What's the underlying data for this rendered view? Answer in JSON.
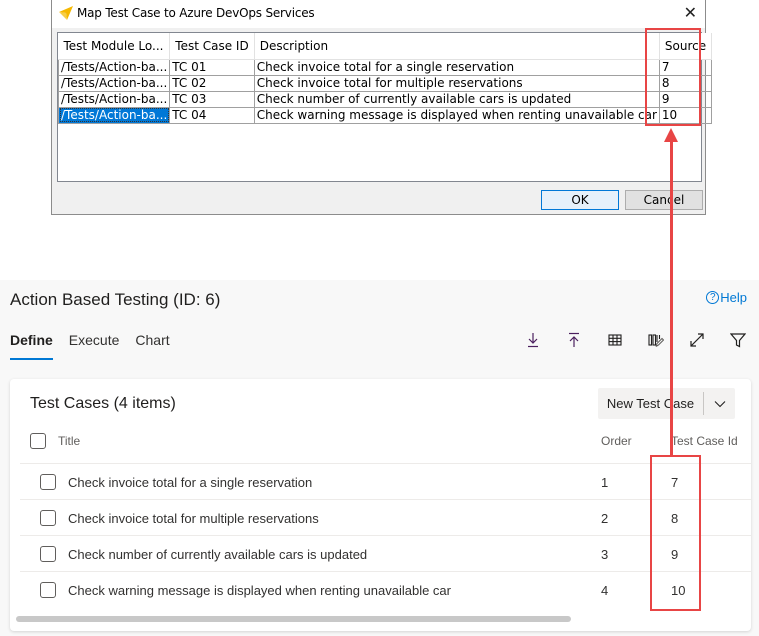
{
  "dialog": {
    "title": "Map Test Case to Azure DevOps Services",
    "close_glyph": "✕",
    "columns": [
      "Test Module Lo...",
      "Test Case ID",
      "Description",
      "Source"
    ],
    "rows": [
      {
        "module": "/Tests/Action-ba...",
        "id": "TC 01",
        "description": "Check invoice total for a single reservation",
        "source": "7"
      },
      {
        "module": "/Tests/Action-ba...",
        "id": "TC 02",
        "description": "Check invoice total for multiple reservations",
        "source": "8"
      },
      {
        "module": "/Tests/Action-ba...",
        "id": "TC 03",
        "description": "Check number of currently available cars is updated",
        "source": "9"
      },
      {
        "module": "/Tests/Action-ba...",
        "id": "TC 04",
        "description": "Check warning message is displayed when renting unavailable car",
        "source": "10"
      }
    ],
    "selected_row": 3,
    "ok_label": "OK",
    "cancel_label": "Cancel"
  },
  "page": {
    "title": "Action Based Testing (ID: 6)",
    "help_label": "Help",
    "help_glyph": "?",
    "tabs": [
      {
        "label": "Define",
        "active": true
      },
      {
        "label": "Execute",
        "active": false
      },
      {
        "label": "Chart",
        "active": false
      }
    ],
    "toolbar_icons": [
      "download-icon",
      "upload-icon",
      "grid-icon",
      "column-options-icon",
      "expand-icon",
      "filter-icon"
    ],
    "card": {
      "title": "Test Cases (4 items)",
      "new_button_label": "New Test Case",
      "columns": {
        "title": "Title",
        "order": "Order",
        "test_case_id": "Test Case Id"
      },
      "rows": [
        {
          "title": "Check invoice total for a single reservation",
          "order": "1",
          "test_case_id": "7"
        },
        {
          "title": "Check invoice total for multiple reservations",
          "order": "2",
          "test_case_id": "8"
        },
        {
          "title": "Check number of currently available cars is updated",
          "order": "3",
          "test_case_id": "9"
        },
        {
          "title": "Check warning message is displayed when renting unavailable car",
          "order": "4",
          "test_case_id": "10"
        }
      ]
    }
  },
  "colors": {
    "accent": "#0078d4",
    "annotation": "#e84545",
    "selection": "#0078d7"
  }
}
